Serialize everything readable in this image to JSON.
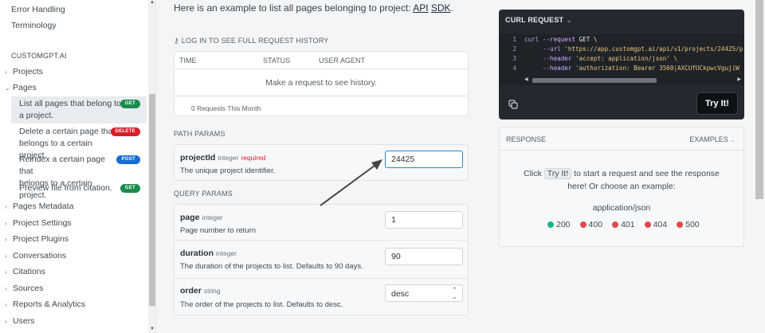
{
  "sidebar": {
    "top_links": [
      "Error Handling",
      "Terminology"
    ],
    "section_heading": "CUSTOMGPT.AI",
    "groups_before": [
      "Projects"
    ],
    "pages_group": "Pages",
    "page_items": [
      {
        "line1": "List all pages that belong to",
        "line2": "a project.",
        "badge": "GET",
        "active": true
      },
      {
        "line1": "Delete a certain page that",
        "line2": "belongs to a certain project.",
        "badge": "DELETE",
        "active": false
      },
      {
        "line1": "Reindex a certain page that",
        "line2": "belongs to a certain project.",
        "badge": "POST",
        "active": false
      },
      {
        "line1": "Preview file from citation.",
        "line2": "",
        "badge": "GET",
        "active": false
      }
    ],
    "groups_after": [
      "Pages Metadata",
      "Project Settings",
      "Project Plugins",
      "Conversations",
      "Citations",
      "Sources",
      "Reports & Analytics",
      "Users"
    ]
  },
  "main": {
    "intro_text": "Here is an example to list all pages belonging to project:",
    "intro_link1": "API",
    "intro_link2": "SDK",
    "intro_end": ".",
    "login_label": "LOG IN TO SEE FULL REQUEST HISTORY",
    "history": {
      "columns": [
        "TIME",
        "STATUS",
        "USER AGENT"
      ],
      "empty_message": "Make a request to see history.",
      "footer": "0 Requests This Month"
    },
    "path_params_label": "PATH PARAMS",
    "path_params": [
      {
        "name": "projectId",
        "type": "integer",
        "required": "required",
        "description": "The unique project identifier.",
        "value": "24425"
      }
    ],
    "query_params_label": "QUERY PARAMS",
    "query_params": [
      {
        "name": "page",
        "type": "integer",
        "description": "Page number to return",
        "value": "1"
      },
      {
        "name": "duration",
        "type": "integer",
        "description": "The duration of the projects to list. Defaults to 90 days.",
        "value": "90"
      },
      {
        "name": "order",
        "type": "string",
        "description": "The order of the projects to list. Defaults to desc.",
        "value": "desc"
      }
    ]
  },
  "curl": {
    "title": "CURL REQUEST",
    "lines": [
      {
        "num": "1",
        "cmd": "curl",
        "flag": " --request",
        "rest": " GET \\"
      },
      {
        "num": "2",
        "cmd": "",
        "flag": "     --url",
        "rest": " 'https://app.customgpt.ai/api/v1/projects/24425/p"
      },
      {
        "num": "3",
        "cmd": "",
        "flag": "     --header",
        "rest": " 'accept: application/json' \\"
      },
      {
        "num": "4",
        "cmd": "",
        "flag": "     --header",
        "rest": " 'authorization: Bearer 3560|AXCUfUCkpwcVgujiW"
      }
    ],
    "try_button": "Try It!",
    "copy_icon": "copy-icon"
  },
  "response": {
    "label": "RESPONSE",
    "examples_label": "EXAMPLES",
    "msg_before": "Click",
    "msg_button": "Try It!",
    "msg_after": "to start a request and see the response here! Or choose an example:",
    "media_type": "application/json",
    "codes": [
      {
        "code": "200",
        "color": "#12b886"
      },
      {
        "code": "400",
        "color": "#e5484d"
      },
      {
        "code": "401",
        "color": "#e5484d"
      },
      {
        "code": "404",
        "color": "#e5484d"
      },
      {
        "code": "500",
        "color": "#e5484d"
      }
    ]
  }
}
